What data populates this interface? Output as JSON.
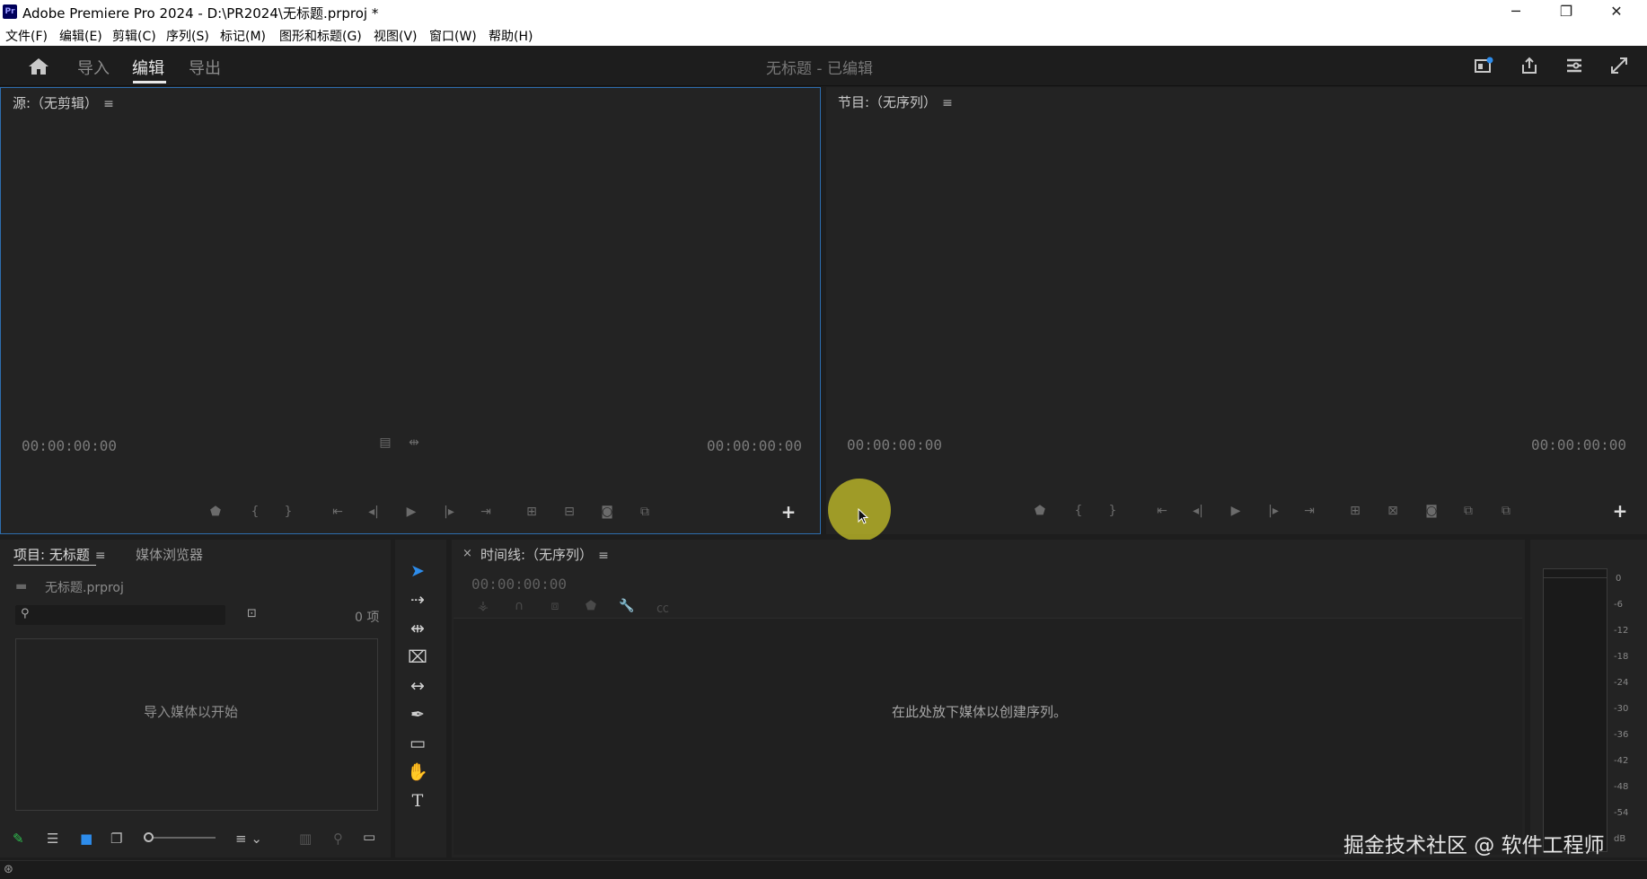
{
  "window": {
    "app_logo": "Pr",
    "title": "Adobe Premiere Pro 2024 - D:\\PR2024\\无标题.prproj *",
    "minimize": "─",
    "restore": "❐",
    "close": "✕"
  },
  "menu": [
    "文件(F)",
    "编辑(E)",
    "剪辑(C)",
    "序列(S)",
    "标记(M)",
    "图形和标题(G)",
    "视图(V)",
    "窗口(W)",
    "帮助(H)"
  ],
  "workspace": {
    "tabs": [
      {
        "label": "导入",
        "active": false
      },
      {
        "label": "编辑",
        "active": true
      },
      {
        "label": "导出",
        "active": false
      }
    ],
    "doc_title": "无标题 - 已编辑"
  },
  "source_monitor": {
    "title": "源:（无剪辑）",
    "menu_icon": "≡",
    "tc_left": "00:00:00:00",
    "tc_right": "00:00:00:00"
  },
  "program_monitor": {
    "title": "节目:（无序列）",
    "menu_icon": "≡",
    "tc_left": "00:00:00:00",
    "tc_right": "00:00:00:00"
  },
  "project_panel": {
    "tab_project": "项目: 无标题",
    "menu_icon": "≡",
    "tab_media": "媒体浏览器",
    "file_name": "无标题.prproj",
    "item_count": "0 项",
    "empty_message": "导入媒体以开始"
  },
  "timeline": {
    "close": "×",
    "title": "时间线:（无序列）",
    "menu_icon": "≡",
    "timecode": "00:00:00:00",
    "empty_message": "在此处放下媒体以创建序列。"
  },
  "audio_meter": {
    "scale": [
      "0",
      "-6",
      "-12",
      "-18",
      "-24",
      "-30",
      "-36",
      "-42",
      "-48",
      "-54",
      "dB"
    ]
  },
  "watermark": "掘金技术社区 @ 软件工程师",
  "colors": {
    "accent": "#2d8ceb",
    "panel_bg": "#232323",
    "app_bg": "#1d1d1d"
  }
}
